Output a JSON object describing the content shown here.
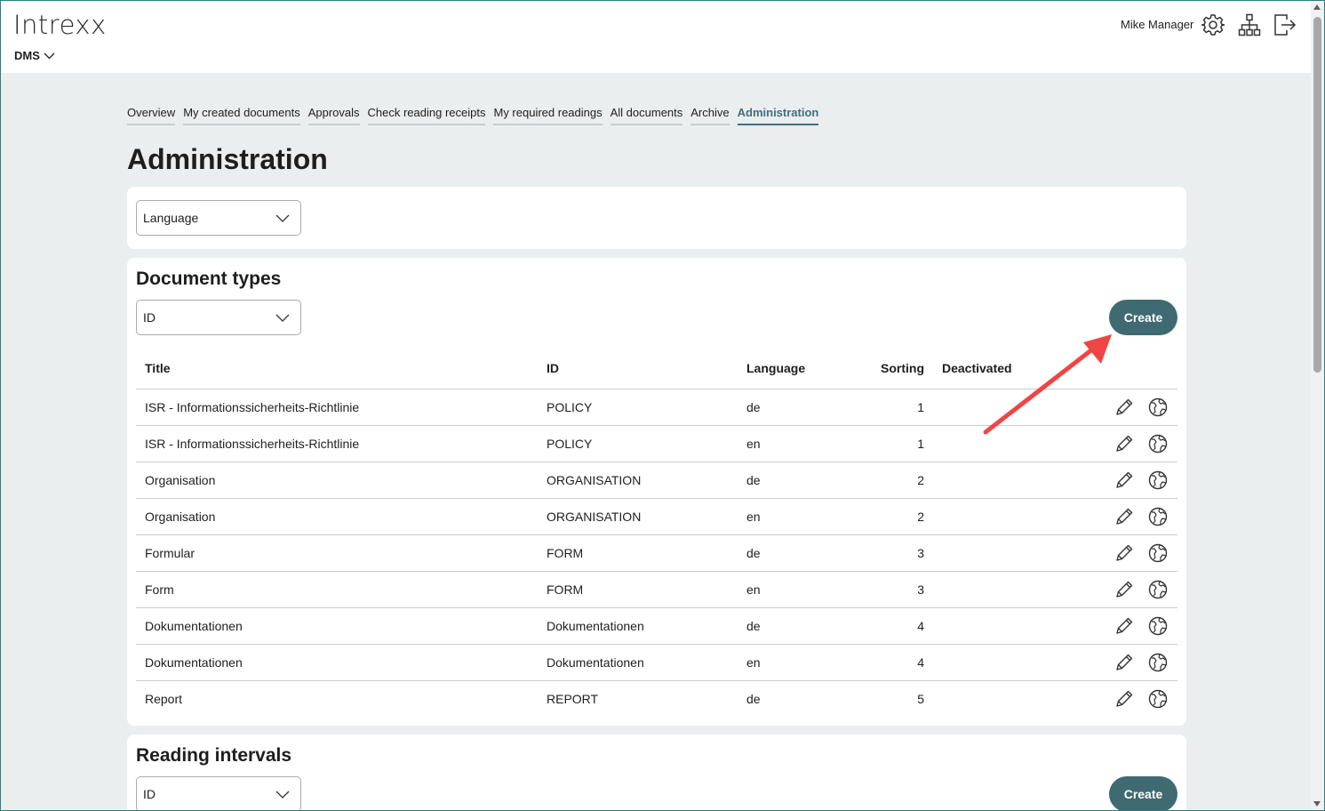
{
  "header": {
    "logo": "Intrexx",
    "app_switch": "DMS",
    "user_name": "Mike Manager",
    "icons": [
      "gear-icon",
      "org-chart-icon",
      "logout-icon"
    ]
  },
  "tabs": [
    {
      "label": "Overview",
      "active": false
    },
    {
      "label": "My created documents",
      "active": false
    },
    {
      "label": "Approvals",
      "active": false
    },
    {
      "label": "Check reading receipts",
      "active": false
    },
    {
      "label": "My required readings",
      "active": false
    },
    {
      "label": "All documents",
      "active": false
    },
    {
      "label": "Archive",
      "active": false
    },
    {
      "label": "Administration",
      "active": true
    }
  ],
  "page_title": "Administration",
  "language_filter": {
    "value": "Language"
  },
  "document_types": {
    "title": "Document types",
    "sort_select": "ID",
    "create_label": "Create",
    "columns": [
      "Title",
      "ID",
      "Language",
      "Sorting",
      "Deactivated"
    ],
    "rows": [
      {
        "title": "ISR - Informationssicherheits-Richtlinie",
        "id": "POLICY",
        "language": "de",
        "sorting": "1",
        "deactivated": ""
      },
      {
        "title": "ISR - Informationssicherheits-Richtlinie",
        "id": "POLICY",
        "language": "en",
        "sorting": "1",
        "deactivated": ""
      },
      {
        "title": "Organisation",
        "id": "ORGANISATION",
        "language": "de",
        "sorting": "2",
        "deactivated": ""
      },
      {
        "title": "Organisation",
        "id": "ORGANISATION",
        "language": "en",
        "sorting": "2",
        "deactivated": ""
      },
      {
        "title": "Formular",
        "id": "FORM",
        "language": "de",
        "sorting": "3",
        "deactivated": ""
      },
      {
        "title": "Form",
        "id": "FORM",
        "language": "en",
        "sorting": "3",
        "deactivated": ""
      },
      {
        "title": "Dokumentationen",
        "id": "Dokumentationen",
        "language": "de",
        "sorting": "4",
        "deactivated": ""
      },
      {
        "title": "Dokumentationen",
        "id": "Dokumentationen",
        "language": "en",
        "sorting": "4",
        "deactivated": ""
      },
      {
        "title": "Report",
        "id": "REPORT",
        "language": "de",
        "sorting": "5",
        "deactivated": ""
      }
    ],
    "row_actions": [
      "pencil-icon",
      "globe-icon"
    ]
  },
  "reading_intervals": {
    "title": "Reading intervals",
    "sort_select": "ID",
    "create_label": "Create"
  },
  "colors": {
    "accent": "#3f6a72",
    "active_tab": "#3f6f80",
    "background": "#ebeeee",
    "annotation_arrow": "#f04545"
  }
}
